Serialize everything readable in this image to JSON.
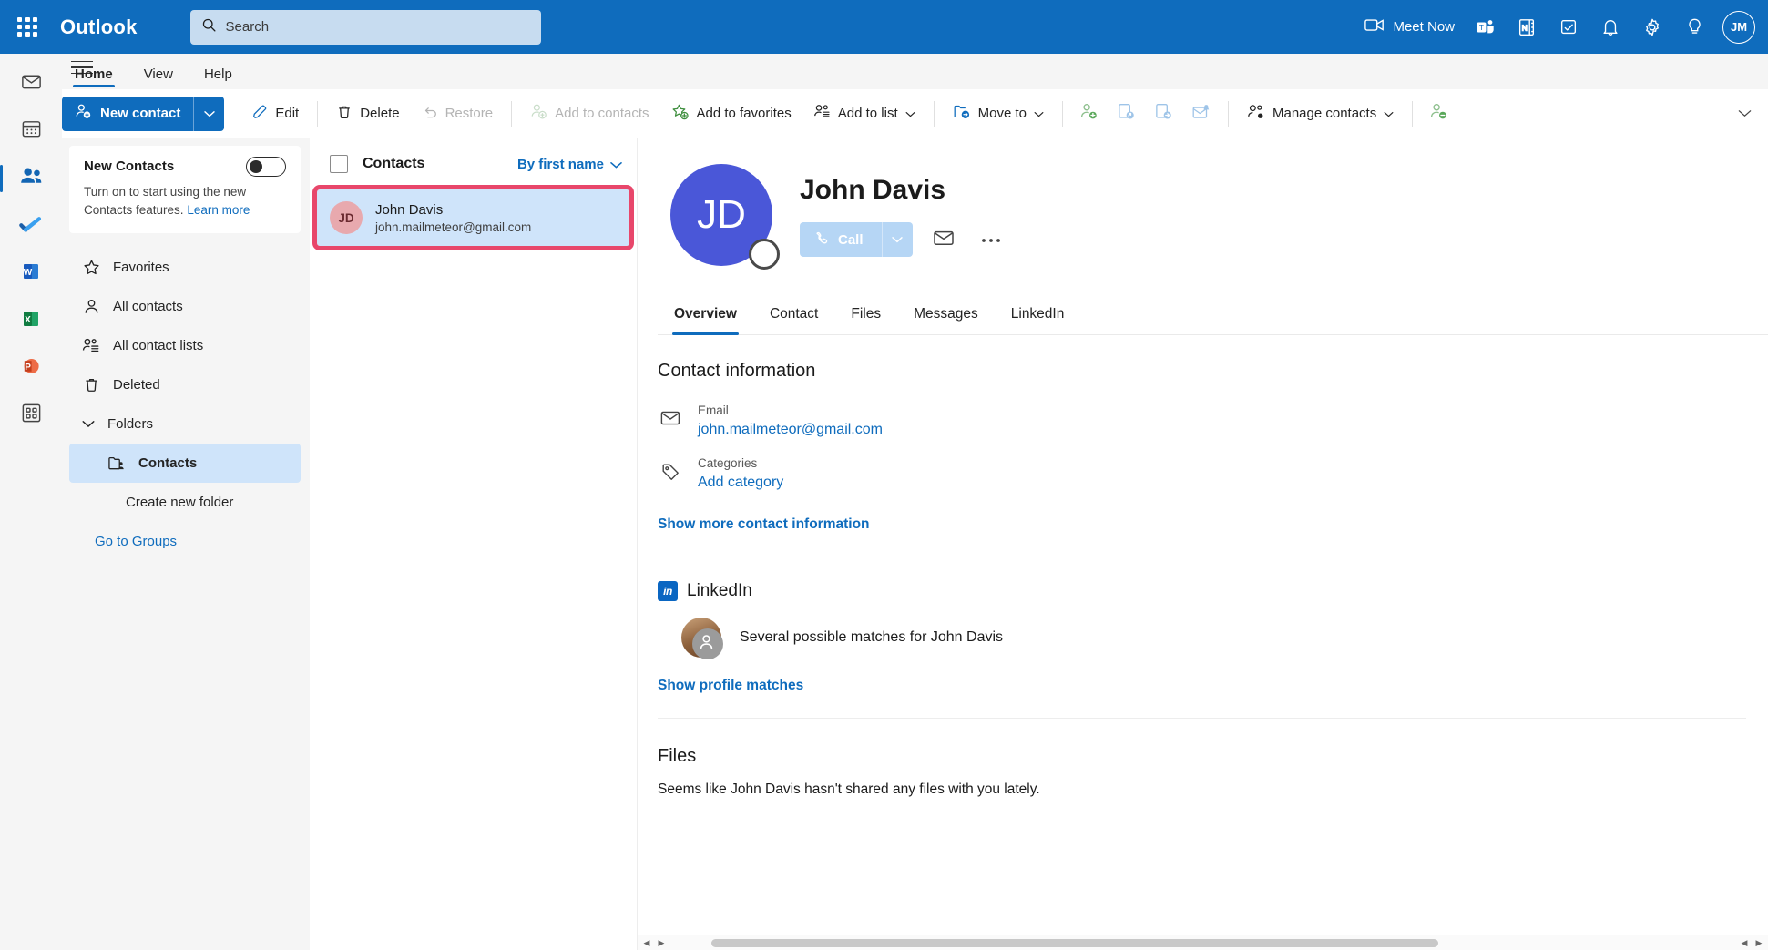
{
  "topbar": {
    "brand": "Outlook",
    "search_placeholder": "Search",
    "meet_now_label": "Meet Now",
    "avatar_initials": "JM",
    "icons": {
      "waffle": "app-launcher-icon",
      "search": "search-icon",
      "meet_now": "video-camera-icon",
      "teams": "teams-icon",
      "onenote": "onenote-icon",
      "todo": "to-do-icon",
      "notifications": "bell-icon",
      "settings": "gear-icon",
      "tips": "lightbulb-icon"
    }
  },
  "ribbon": {
    "tabs": [
      {
        "label": "Home",
        "active": true
      },
      {
        "label": "View",
        "active": false
      },
      {
        "label": "Help",
        "active": false
      }
    ]
  },
  "commandbar": {
    "new_contact": "New contact",
    "items": [
      {
        "label": "Edit",
        "icon": "pencil-icon",
        "disabled": false,
        "caret": false
      },
      {
        "label": "Delete",
        "icon": "trash-icon",
        "disabled": false,
        "caret": false
      },
      {
        "label": "Restore",
        "icon": "undo-icon",
        "disabled": true,
        "caret": false
      },
      {
        "label": "Add to contacts",
        "icon": "add-person-icon",
        "disabled": true,
        "caret": false
      },
      {
        "label": "Add to favorites",
        "icon": "star-add-icon",
        "disabled": false,
        "caret": false
      },
      {
        "label": "Add to list",
        "icon": "people-list-icon",
        "disabled": false,
        "caret": true
      },
      {
        "label": "Move to",
        "icon": "folder-arrow-icon",
        "disabled": false,
        "caret": true
      }
    ],
    "icon_only": [
      {
        "name": "add-person-icon"
      },
      {
        "name": "share-contact-icon"
      },
      {
        "name": "forward-contact-icon"
      },
      {
        "name": "mail-reminder-icon"
      }
    ],
    "manage_contacts": "Manage contacts",
    "icon_only_trailing": [
      {
        "name": "remove-person-icon"
      }
    ],
    "overflow": "chevron-down-icon"
  },
  "rail": {
    "items": [
      {
        "name": "mail-icon",
        "active": false
      },
      {
        "name": "calendar-icon",
        "active": false
      },
      {
        "name": "people-icon",
        "active": true
      },
      {
        "name": "to-do-icon",
        "active": false
      },
      {
        "name": "word-icon",
        "active": false
      },
      {
        "name": "excel-icon",
        "active": false
      },
      {
        "name": "powerpoint-icon",
        "active": false
      },
      {
        "name": "apps-icon",
        "active": false
      }
    ]
  },
  "leftnav": {
    "promo": {
      "title": "New Contacts",
      "body": "Turn on to start using the new Contacts features.",
      "link": "Learn more",
      "toggle_on": false
    },
    "items": [
      {
        "label": "Favorites",
        "icon": "star-icon",
        "selected": false
      },
      {
        "label": "All contacts",
        "icon": "person-icon",
        "selected": false
      },
      {
        "label": "All contact lists",
        "icon": "people-list-icon",
        "selected": false
      },
      {
        "label": "Deleted",
        "icon": "trash-icon",
        "selected": false
      }
    ],
    "folders_label": "Folders",
    "folders": [
      {
        "label": "Contacts",
        "icon": "contacts-folder-icon",
        "selected": true
      }
    ],
    "create_new_folder": "Create new folder",
    "go_to_groups": "Go to Groups"
  },
  "listpane": {
    "title": "Contacts",
    "sort_label": "By first name",
    "contacts": [
      {
        "initials": "JD",
        "name": "John Davis",
        "email": "john.mailmeteor@gmail.com",
        "selected": true
      }
    ]
  },
  "detail": {
    "initials": "JD",
    "name": "John Davis",
    "call_label": "Call",
    "tabs": [
      {
        "label": "Overview",
        "active": true
      },
      {
        "label": "Contact",
        "active": false
      },
      {
        "label": "Files",
        "active": false
      },
      {
        "label": "Messages",
        "active": false
      },
      {
        "label": "LinkedIn",
        "active": false
      }
    ],
    "contact_information": {
      "heading": "Contact information",
      "rows": [
        {
          "label": "Email",
          "value": "john.mailmeteor@gmail.com",
          "icon": "envelope-icon"
        },
        {
          "label": "Categories",
          "value": "Add category",
          "icon": "tag-icon"
        }
      ],
      "show_more": "Show more contact information"
    },
    "linkedin": {
      "heading": "LinkedIn",
      "badge": "in",
      "match_text": "Several possible matches for John Davis",
      "show_profiles": "Show profile matches"
    },
    "files": {
      "heading": "Files",
      "empty_text": "Seems like John Davis hasn't shared any files with you lately."
    }
  },
  "colors": {
    "accent": "#0f6cbd",
    "selection": "#cfe4fa",
    "highlight_outline": "#e8476b",
    "avatar_detail": "#4a57d8",
    "avatar_list": "#e8a9ae",
    "linkedin": "#0a66c2"
  }
}
